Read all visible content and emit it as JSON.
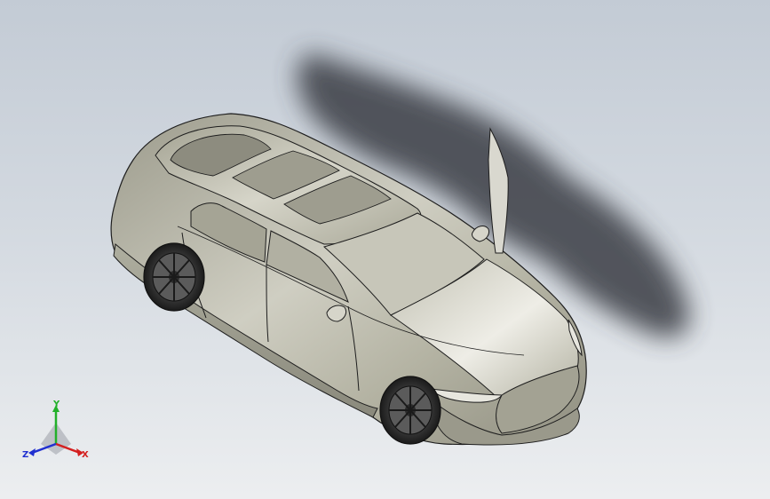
{
  "viewport": {
    "background_top": "#c3cbd5",
    "background_bottom": "#eceef0"
  },
  "model": {
    "body_color": "#bdbcae",
    "shadow_color": "#3a3e44",
    "wheel_color": "#2a2a2a"
  },
  "triad": {
    "x_label": "X",
    "y_label": "Y",
    "z_label": "Z",
    "x_color": "#d42020",
    "y_color": "#22b02a",
    "z_color": "#2030d0"
  }
}
